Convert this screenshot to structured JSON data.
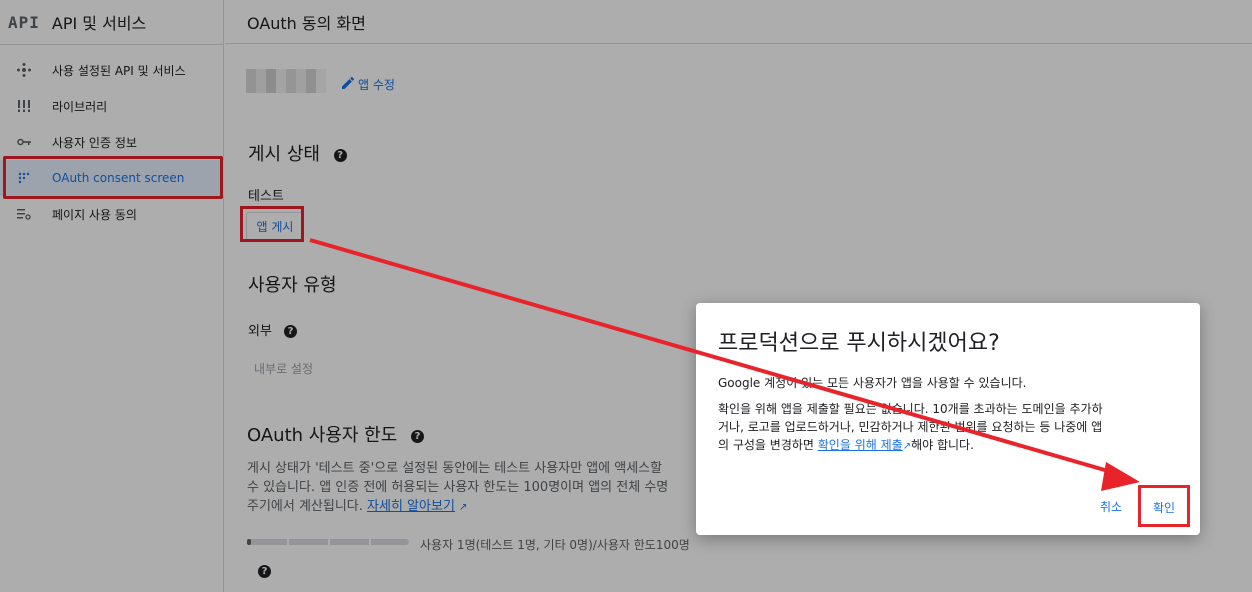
{
  "sidebar": {
    "logo": "API",
    "title": "API 및 서비스",
    "items": [
      {
        "label": "사용 설정된 API 및 서비스",
        "icon": "api-icon"
      },
      {
        "label": "라이브러리",
        "icon": "library-icon"
      },
      {
        "label": "사용자 인증 정보",
        "icon": "key-icon"
      },
      {
        "label": "OAuth consent screen",
        "icon": "consent-icon"
      },
      {
        "label": "페이지 사용 동의",
        "icon": "settings-list-icon"
      }
    ]
  },
  "main": {
    "header": "OAuth 동의 화면",
    "edit_app": "앱 수정",
    "publishing_status": {
      "heading": "게시 상태",
      "status": "테스트",
      "publish_button": "앱 게시"
    },
    "user_type": {
      "heading": "사용자 유형",
      "value": "외부",
      "make_internal": "내부로 설정"
    },
    "user_cap": {
      "heading": "OAuth 사용자 한도",
      "line1": "게시 상태가 '테스트 중'으로 설정된 동안에는 테스트 사용자만 앱에 액세스할",
      "line2": "수 있습니다. 앱 인증 전에 허용되는 사용자 한도는 100명이며 앱의 전체 수명",
      "line3": "주기에서 계산됩니다.",
      "learn_more": "자세히 알아보기",
      "usage": "사용자 1명(테스트 1명, 기타 0명)/사용자 한도100명",
      "usage_fraction": 0.01
    }
  },
  "dialog": {
    "title": "프로덕션으로 푸시하시겠어요?",
    "line1": "Google 계정이 있는 모든 사용자가 앱을 사용할 수 있습니다.",
    "line2": "확인을 위해 앱을 제출할 필요는 없습니다. 10개를 초과하는 도메인을 추가하",
    "line3": "거나, 로고를 업로드하거나, 민감하거나 제한된 범위를 요청하는 등 나중에 앱",
    "line4_pre": "의 구성을 변경하면 ",
    "line4_link": "확인을 위해 제출",
    "line4_post": "해야 합니다.",
    "cancel": "취소",
    "confirm": "확인"
  },
  "colors": {
    "accent": "#1a73e8",
    "annotation": "#e8232a"
  }
}
